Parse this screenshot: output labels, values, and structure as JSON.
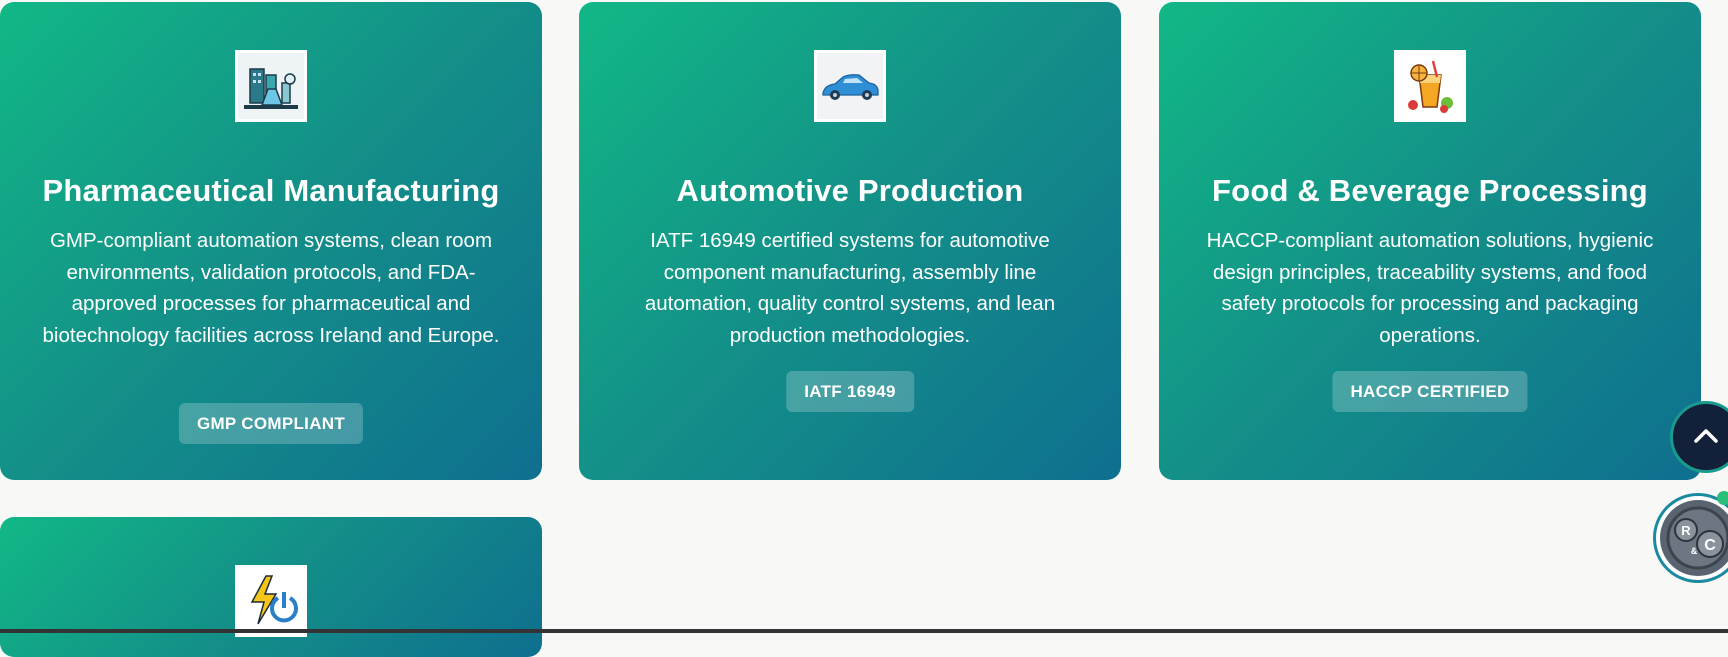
{
  "cards": [
    {
      "icon": "laboratory-icon",
      "title": "Pharmaceutical Manufacturing",
      "description": "GMP-compliant automation systems, clean room environments, validation protocols, and FDA-approved processes for pharmaceutical and biotechnology facilities across Ireland and Europe.",
      "badge": "GMP COMPLIANT"
    },
    {
      "icon": "car-icon",
      "title": "Automotive Production",
      "description": "IATF 16949 certified systems for automotive component manufacturing, assembly line automation, quality control systems, and lean production methodologies.",
      "badge": "IATF 16949"
    },
    {
      "icon": "beverage-icon",
      "title": "Food & Beverage Processing",
      "description": "HACCP-compliant automation solutions, hygienic design principles, traceability systems, and food safety protocols for processing and packaging operations.",
      "badge": "HACCP CERTIFIED"
    },
    {
      "icon": "energy-power-icon"
    }
  ],
  "colors": {
    "card_gradient_start": "#12b886",
    "card_gradient_end": "#0f6f8f",
    "page_background": "#f8f8f6",
    "scroll_button": "#12203a"
  },
  "floating": {
    "scroll_top_icon": "chevron-up-icon",
    "logo_letters": "R&C"
  }
}
